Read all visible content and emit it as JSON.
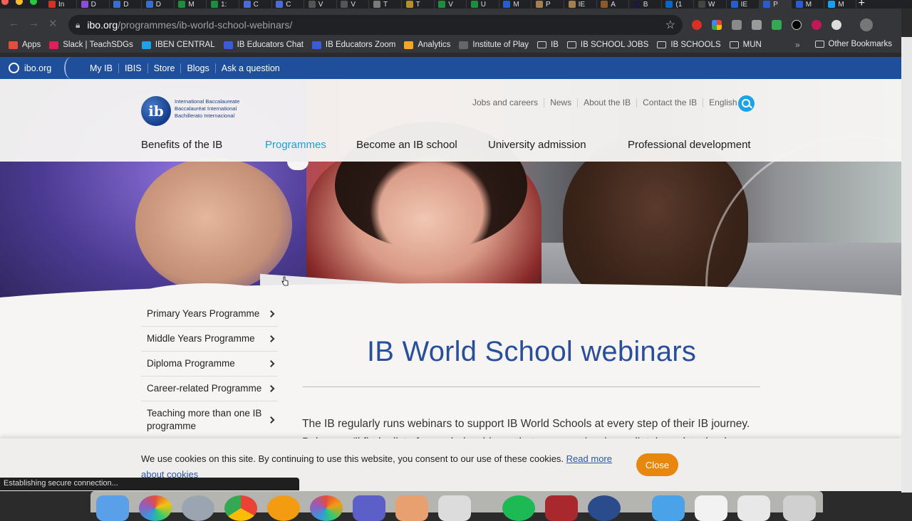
{
  "browser": {
    "tabs": [
      {
        "label": "In",
        "color": "#d93025"
      },
      {
        "label": "D",
        "color": "#8a4fd6"
      },
      {
        "label": "D",
        "color": "#3b6ecc"
      },
      {
        "label": "D",
        "color": "#3b6ecc"
      },
      {
        "label": "M",
        "color": "#1e8e3e"
      },
      {
        "label": "1:",
        "color": "#1e8e3e"
      },
      {
        "label": "C",
        "color": "#4a6cd4"
      },
      {
        "label": "C",
        "color": "#4a6cd4"
      },
      {
        "label": "V",
        "color": "#555"
      },
      {
        "label": "V",
        "color": "#555"
      },
      {
        "label": "T",
        "color": "#7a7a7a"
      },
      {
        "label": "T",
        "color": "#b48f2a"
      },
      {
        "label": "V",
        "color": "#1e8e3e"
      },
      {
        "label": "U",
        "color": "#1e8e3e"
      },
      {
        "label": "M",
        "color": "#2a5bd7"
      },
      {
        "label": "P",
        "color": "#a57f4f"
      },
      {
        "label": "IE",
        "color": "#a57f4f"
      },
      {
        "label": "A",
        "color": "#8a5a2b"
      },
      {
        "label": "B",
        "color": "#1a1a3a"
      },
      {
        "label": "(1",
        "color": "#0a66c2"
      },
      {
        "label": "W",
        "color": "#444"
      },
      {
        "label": "IE",
        "color": "#2a5bd7"
      },
      {
        "label": "P",
        "color": "#2a5bd7"
      },
      {
        "label": "M",
        "color": "#2a5bd7"
      },
      {
        "label": "M",
        "color": "#1aa0e8"
      }
    ],
    "url_host": "ibo.org",
    "url_path": "/programmes/ib-world-school-webinars/",
    "bookmarks": [
      {
        "label": "Apps",
        "icon": "apps-grid-icon",
        "color": "#e84c3d"
      },
      {
        "label": "Slack | TeachSDGs",
        "icon": "slack-icon",
        "color": "#e01e5a"
      },
      {
        "label": "IBEN CENTRAL",
        "icon": "cloud-icon",
        "color": "#1aa3e8"
      },
      {
        "label": "IB Educators Chat",
        "icon": "window-icon",
        "color": "#3b5bdb"
      },
      {
        "label": "IB Educators Zoom",
        "icon": "window-icon",
        "color": "#3b5bdb"
      },
      {
        "label": "Analytics",
        "icon": "analytics-icon",
        "color": "#f5a623"
      },
      {
        "label": "Institute of Play",
        "icon": "globe-icon",
        "color": "#666"
      },
      {
        "label": "IB",
        "icon": "folder-icon",
        "color": "#cfd2d6"
      },
      {
        "label": "IB SCHOOL JOBS",
        "icon": "folder-icon",
        "color": "#cfd2d6"
      },
      {
        "label": "IB SCHOOLS",
        "icon": "folder-icon",
        "color": "#cfd2d6"
      },
      {
        "label": "MUN",
        "icon": "folder-icon",
        "color": "#cfd2d6"
      }
    ],
    "other_bookmarks": "Other Bookmarks",
    "status": "Establishing secure connection..."
  },
  "site_bar": {
    "site_name": "ibo.org",
    "links": [
      "My IB",
      "IBIS",
      "Store",
      "Blogs",
      "Ask a question"
    ]
  },
  "header": {
    "logo_mark": "ib",
    "logo_lines": [
      "International Baccalaureate",
      "Baccalauréat International",
      "Bachillerato Internacional"
    ],
    "utility_links": [
      "Jobs and careers",
      "News",
      "About the IB",
      "Contact the IB"
    ],
    "language": "English ▾",
    "nav": [
      "Benefits of the IB",
      "Programmes",
      "Become an IB school",
      "University admission",
      "Professional development"
    ]
  },
  "sidebar": {
    "items": [
      "Primary Years Programme",
      "Middle Years Programme",
      "Diploma Programme",
      "Career-related Programme",
      "Teaching more than one IB programme"
    ]
  },
  "content": {
    "title": "IB World School webinars",
    "intro": "The IB regularly runs webinars to support IB World Schools at every step of their IB journey. Below you'll find a list of recorded webinars that you can view immediately or download."
  },
  "cookie": {
    "text": "We use cookies on this site. By continuing to use this website, you consent to our use of these cookies.",
    "link": "Read more about cookies",
    "close": "Close"
  },
  "colors": {
    "ib_blue": "#1f4e9a",
    "accent_cyan": "#1aa0d8",
    "title_blue": "#2a4f9a",
    "cookie_button": "#e8870e"
  }
}
